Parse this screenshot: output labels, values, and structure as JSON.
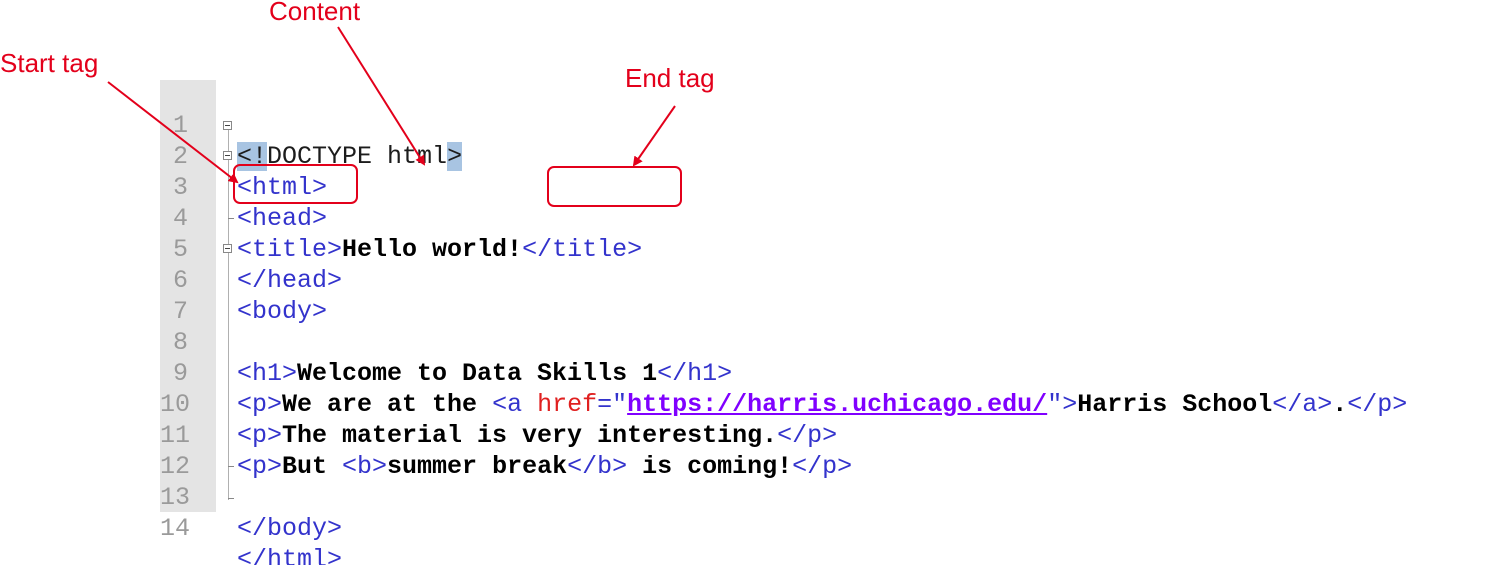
{
  "annotations": {
    "start_tag": "Start tag",
    "content": "Content",
    "end_tag": "End tag"
  },
  "code_lines": [
    {
      "n": "1"
    },
    {
      "n": "2"
    },
    {
      "n": "3"
    },
    {
      "n": "4"
    },
    {
      "n": "5"
    },
    {
      "n": "6"
    },
    {
      "n": "7"
    },
    {
      "n": "8"
    },
    {
      "n": "9"
    },
    {
      "n": "10"
    },
    {
      "n": "11"
    },
    {
      "n": "12"
    },
    {
      "n": "13"
    },
    {
      "n": "14"
    }
  ],
  "code": {
    "l1_lt": "<",
    "l1_bang": "!",
    "l1_doctype": "DOCTYPE html",
    "l1_gt": ">",
    "l2": "<html>",
    "l3": "<head>",
    "l4_open": "<title>",
    "l4_text": "Hello world!",
    "l4_close": "</title>",
    "l5": "</head>",
    "l6": "<body>",
    "l8_open": "<h1>",
    "l8_text": "Welcome to Data Skills 1",
    "l8_close": "</h1>",
    "l9_popen": "<p>",
    "l9_text1": "We are at the ",
    "l9_a_open": "<a ",
    "l9_attr": "href",
    "l9_eq": "=\"",
    "l9_url": "https://harris.uchicago.edu/",
    "l9_q_gt": "\">",
    "l9_link_text": "Harris School",
    "l9_a_close": "</a>",
    "l9_dot": ".",
    "l9_pclose": "</p>",
    "l10_open": "<p>",
    "l10_text": "The material is very interesting.",
    "l10_close": "</p>",
    "l11_open": "<p>",
    "l11_text1": "But ",
    "l11_b_open": "<b>",
    "l11_b_text": "summer break",
    "l11_b_close": "</b>",
    "l11_text2": " is coming!",
    "l11_close": "</p>",
    "l13": "</body>",
    "l14": "</html>"
  },
  "colors": {
    "annotation": "#e3001b",
    "tag": "#3333cc",
    "attribute": "#e02020",
    "url": "#8000ff",
    "gutter": "#e4e4e4",
    "highlight": "#a8c4e2"
  }
}
